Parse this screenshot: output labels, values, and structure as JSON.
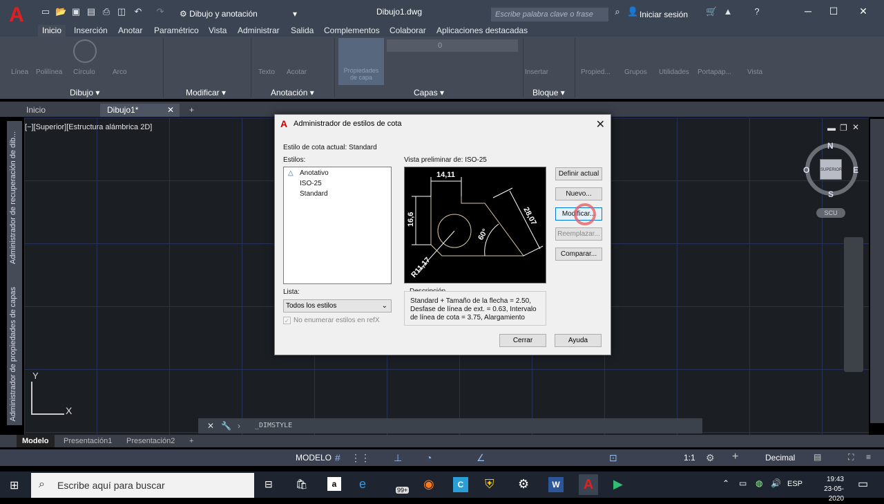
{
  "app": {
    "title": "Dibujo1.dwg",
    "workspace": "Dibujo y anotación",
    "search_placeholder": "Escribe palabra clave o frase",
    "signin": "Iniciar sesión"
  },
  "ribbon_tabs": [
    "Inicio",
    "Inserción",
    "Anotar",
    "Paramétrico",
    "Vista",
    "Administrar",
    "Salida",
    "Complementos",
    "Colaborar",
    "Aplicaciones destacadas"
  ],
  "panels": [
    "Dibujo",
    "Modificar",
    "Anotación",
    "Capas",
    "Bloque"
  ],
  "panel_buttons": {
    "linea": "Línea",
    "polilinea": "Polilínea",
    "circulo": "Círculo",
    "arco": "Arco",
    "texto": "Texto",
    "acotar": "Acotar",
    "propiedades_capas": "Propiedades de capa",
    "insertar": "Insertar",
    "propiedades": "Propied...",
    "grupos": "Grupos",
    "utilidades": "Utilidades",
    "portapapeles": "Portapap...",
    "vista": "Vista",
    "layer_value": "0"
  },
  "file_tabs": [
    "Inicio",
    "Dibujo1*"
  ],
  "viewport_label": "[−][Superior][Estructura alámbrica 2D]",
  "sidebar": {
    "recovery": "Administrador de recuperación de dib...",
    "layers": "Administrador de propiedades de capas"
  },
  "viewcube": {
    "n": "N",
    "s": "S",
    "e": "E",
    "o": "O",
    "face": "SUPERIOR",
    "ucs": "SCU"
  },
  "ucs": {
    "x": "X",
    "y": "Y"
  },
  "command": {
    "text": "_DIMSTYLE"
  },
  "layout_tabs": [
    "Modelo",
    "Presentación1",
    "Presentación2"
  ],
  "status": {
    "modelo": "MODELO",
    "scale": "1:1",
    "units": "Decimal"
  },
  "dialog": {
    "title": "Administrador de estilos de cota",
    "current": "Estilo de cota actual: Standard",
    "styles_label": "Estilos:",
    "styles": [
      "Anotativo",
      "ISO-25",
      "Standard"
    ],
    "preview_label": "Vista preliminar de: ISO-25",
    "list_label": "Lista:",
    "list_value": "Todos los estilos",
    "xref_label": "No enumerar estilos en refX",
    "desc_label": "Descripción",
    "desc_lines": [
      "Standard + Tamaño de la flecha = 2.50,",
      "Desfase de línea de ext. = 0.63, Intervalo",
      "de línea de cota = 3.75, Alargamiento"
    ],
    "buttons": {
      "set_current": "Definir actual",
      "new": "Nuevo...",
      "modify": "Modificar...",
      "override": "Reemplazar...",
      "compare": "Comparar...",
      "close": "Cerrar",
      "help": "Ayuda"
    },
    "preview_dims": {
      "top": "14,11",
      "left": "16,6",
      "diag": "28,07",
      "angle": "60°",
      "radius": "R11,17"
    }
  },
  "taskbar": {
    "search": "Escribe aquí para buscar",
    "badge": "99+",
    "lang": "ESP",
    "time": "19:43",
    "date": "23-05-2020"
  }
}
